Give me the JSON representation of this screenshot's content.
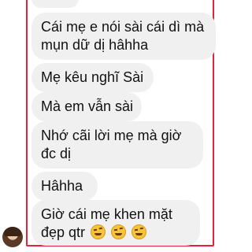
{
  "messages": [
    {
      "lines": [
        "Cái mẹ e nói sài cái dì mà",
        "mụn dữ dị hâhha"
      ]
    },
    {
      "lines": [
        "Mẹ kêu nghĩ Sài"
      ]
    },
    {
      "lines": [
        "Mà em vẫn sài"
      ]
    },
    {
      "lines": [
        "Nhớ cãi lời mẹ mà giờ",
        "đc dị"
      ]
    },
    {
      "lines": [
        "Hâhha"
      ]
    },
    {
      "lines": [
        "Giờ cái mẹ khen mặt",
        "đẹp qtr"
      ]
    }
  ],
  "emojis": [
    "laughing-rolling-face",
    "laughing-rolling-face",
    "laughing-rolling-face"
  ],
  "colors": {
    "bubble": "#f0f0f0",
    "highlight": "#e0243b",
    "text": "#111111"
  }
}
